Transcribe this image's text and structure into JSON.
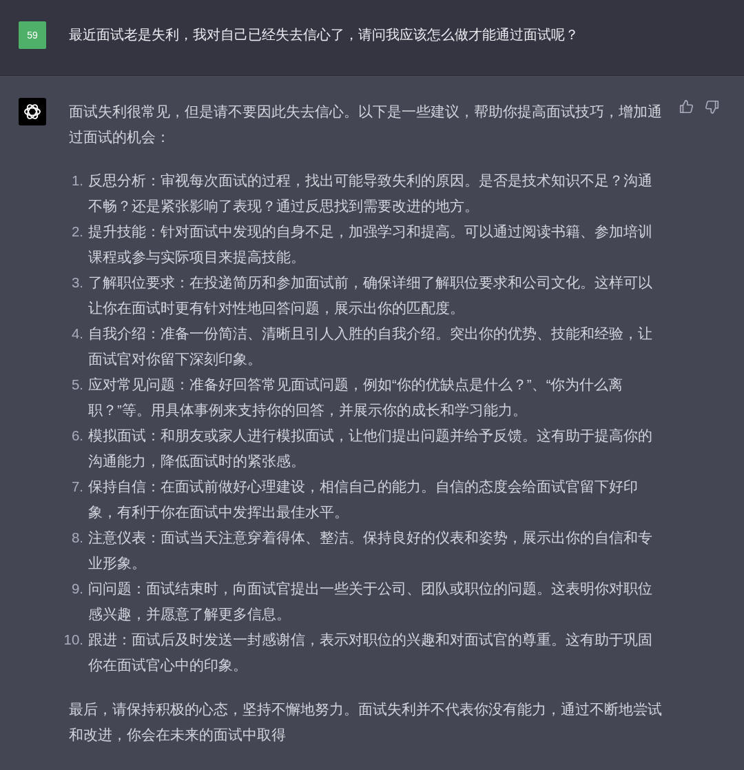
{
  "user_message": {
    "avatar_label": "59",
    "text": "最近面试老是失利，我对自己已经失去信心了，请问我应该怎么做才能通过面试呢？"
  },
  "assistant_message": {
    "intro": "面试失利很常见，但是请不要因此失去信心。以下是一些建议，帮助你提高面试技巧，增加通过面试的机会：",
    "items": [
      {
        "number": "1.",
        "text": "反思分析：审视每次面试的过程，找出可能导致失利的原因。是否是技术知识不足？沟通不畅？还是紧张影响了表现？通过反思找到需要改进的地方。"
      },
      {
        "number": "2.",
        "text": "提升技能：针对面试中发现的自身不足，加强学习和提高。可以通过阅读书籍、参加培训课程或参与实际项目来提高技能。"
      },
      {
        "number": "3.",
        "text": "了解职位要求：在投递简历和参加面试前，确保详细了解职位要求和公司文化。这样可以让你在面试时更有针对性地回答问题，展示出你的匹配度。"
      },
      {
        "number": "4.",
        "text": "自我介绍：准备一份简洁、清晰且引人入胜的自我介绍。突出你的优势、技能和经验，让面试官对你留下深刻印象。"
      },
      {
        "number": "5.",
        "text": "应对常见问题：准备好回答常见面试问题，例如“你的优缺点是什么？”、“你为什么离职？”等。用具体事例来支持你的回答，并展示你的成长和学习能力。"
      },
      {
        "number": "6.",
        "text": "模拟面试：和朋友或家人进行模拟面试，让他们提出问题并给予反馈。这有助于提高你的沟通能力，降低面试时的紧张感。"
      },
      {
        "number": "7.",
        "text": "保持自信：在面试前做好心理建设，相信自己的能力。自信的态度会给面试官留下好印象，有利于你在面试中发挥出最佳水平。"
      },
      {
        "number": "8.",
        "text": "注意仪表：面试当天注意穿着得体、整洁。保持良好的仪表和姿势，展示出你的自信和专业形象。"
      },
      {
        "number": "9.",
        "text": "问问题：面试结束时，向面试官提出一些关于公司、团队或职位的问题。这表明你对职位感兴趣，并愿意了解更多信息。"
      },
      {
        "number": "10.",
        "text": "跟进：面试后及时发送一封感谢信，表示对职位的兴趣和对面试官的尊重。这有助于巩固你在面试官心中的印象。"
      }
    ],
    "closing": "最后，请保持积极的心态，坚持不懈地努力。面试失利并不代表你没有能力，通过不断地尝试和改进，你会在未来的面试中取得"
  }
}
